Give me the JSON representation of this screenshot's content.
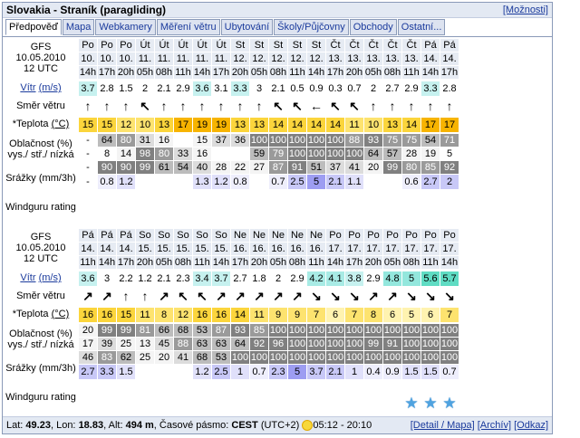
{
  "title": "Slovakia - Straník (paragliding)",
  "moznosti": "[Možnosti]",
  "tabs": [
    "Předpověď",
    "Mapa",
    "Webkamery",
    "Měření větru",
    "Ubytování",
    "Školy/Půjčovny",
    "Obchody",
    "Ostatní..."
  ],
  "labels": {
    "model": "GFS",
    "date": "10.05.2010",
    "utc": "12 UTC",
    "wind": "Vítr",
    "wind_unit": "(m/s)",
    "dir": "Směr větru",
    "temp": "*Teplota",
    "temp_unit": "(°C)",
    "cloud1": "Oblačnost (%)",
    "cloud2": "vys./ stř./ nízká",
    "rain": "Srážky (mm/3h)",
    "rating": "Windguru rating"
  },
  "blocks": [
    {
      "days": [
        "Po",
        "Po",
        "Po",
        "Út",
        "Út",
        "Út",
        "Út",
        "Út",
        "St",
        "St",
        "St",
        "St",
        "St",
        "Čt",
        "Čt",
        "Čt",
        "Čt",
        "Čt",
        "Pá",
        "Pá"
      ],
      "dates": [
        "10.",
        "10.",
        "10.",
        "11.",
        "11.",
        "11.",
        "11.",
        "11.",
        "12.",
        "12.",
        "12.",
        "12.",
        "12.",
        "13.",
        "13.",
        "13.",
        "13.",
        "13.",
        "14.",
        "14."
      ],
      "times": [
        "14h",
        "17h",
        "20h",
        "05h",
        "08h",
        "11h",
        "14h",
        "17h",
        "20h",
        "05h",
        "08h",
        "11h",
        "14h",
        "17h",
        "20h",
        "05h",
        "08h",
        "11h",
        "14h",
        "17h"
      ],
      "wind": [
        "3.7",
        "2.8",
        "1.5",
        "2",
        "2.1",
        "2.9",
        "3.6",
        "3.1",
        "3.3",
        "3",
        "2.1",
        "0.5",
        "0.9",
        "0.3",
        "0.7",
        "2",
        "2.7",
        "2.9",
        "3.3",
        "2.8"
      ],
      "wind_colors": [
        "#c6f1ef",
        "",
        "",
        "",
        "",
        "",
        "#c6f1ef",
        "",
        "#c6f1ef",
        "",
        "",
        "",
        "",
        "",
        "",
        "",
        "",
        "",
        "#c6f1ef",
        ""
      ],
      "dir": [
        "↑",
        "↑",
        "↑",
        "↖",
        "↑",
        "↑",
        "↑",
        "↑",
        "↑",
        "↑",
        "↖",
        "↖",
        "←",
        "↖",
        "↖",
        "↑",
        "↑",
        "↑",
        "↑",
        "↑"
      ],
      "temp": [
        "15",
        "15",
        "12",
        "10",
        "13",
        "17",
        "19",
        "19",
        "13",
        "13",
        "14",
        "14",
        "14",
        "14",
        "11",
        "10",
        "13",
        "14",
        "17",
        "17"
      ],
      "temp_colors": [
        "#fbd53c",
        "#fbd53c",
        "#fde36f",
        "#fde36f",
        "#fbd53c",
        "#f7b400",
        "#f7b400",
        "#f7b400",
        "#fbd53c",
        "#fbd53c",
        "#fbd53c",
        "#fbd53c",
        "#fbd53c",
        "#fbd53c",
        "#fde36f",
        "#fde36f",
        "#fbd53c",
        "#fbd53c",
        "#f7b400",
        "#f7b400"
      ],
      "cloud_h": [
        "-",
        "64",
        "80",
        "31",
        "16",
        "",
        "15",
        "37",
        "36",
        "100",
        "100",
        "100",
        "100",
        "100",
        "88",
        "93",
        "75",
        "75",
        "54",
        "71"
      ],
      "cloud_m": [
        "-",
        "8",
        "14",
        "98",
        "80",
        "33",
        "16",
        "",
        "",
        "59",
        "79",
        "100",
        "100",
        "100",
        "100",
        "64",
        "57",
        "28",
        "19",
        "5"
      ],
      "cloud_l": [
        "-",
        "90",
        "90",
        "99",
        "61",
        "54",
        "40",
        "28",
        "22",
        "27",
        "87",
        "91",
        "51",
        "37",
        "41",
        "20",
        "99",
        "80",
        "85",
        "92"
      ],
      "rain": [
        "-",
        "0.8",
        "1.2",
        "",
        "",
        "",
        "1.3",
        "1.2",
        "0.8",
        "",
        "0.7",
        "2.5",
        "5",
        "2.1",
        "1.1",
        "",
        "",
        "0.6",
        "2.7",
        "2"
      ],
      "rating": [
        0,
        0,
        0,
        0,
        0,
        0,
        0,
        0,
        0,
        0,
        0,
        0,
        0,
        0,
        0,
        0,
        0,
        0,
        0,
        0
      ]
    },
    {
      "days": [
        "Pá",
        "Pá",
        "Pá",
        "So",
        "So",
        "So",
        "So",
        "So",
        "Ne",
        "Ne",
        "Ne",
        "Ne",
        "Ne",
        "Po",
        "Po",
        "Po",
        "Po",
        "Po",
        "Po",
        "Po"
      ],
      "dates": [
        "14.",
        "14.",
        "14.",
        "15.",
        "15.",
        "15.",
        "15.",
        "15.",
        "16.",
        "16.",
        "16.",
        "16.",
        "16.",
        "17.",
        "17.",
        "17.",
        "17.",
        "17.",
        "17.",
        "17."
      ],
      "times": [
        "11h",
        "14h",
        "17h",
        "20h",
        "05h",
        "08h",
        "11h",
        "14h",
        "17h",
        "20h",
        "05h",
        "08h",
        "11h",
        "14h",
        "17h",
        "20h",
        "05h",
        "08h",
        "11h",
        "14h"
      ],
      "wind": [
        "3.6",
        "3",
        "2.2",
        "1.2",
        "2.1",
        "2.3",
        "3.4",
        "3.7",
        "2.7",
        "1.8",
        "2",
        "2.9",
        "4.2",
        "4.1",
        "3.8",
        "2.9",
        "4.8",
        "5",
        "5.6",
        "5.7"
      ],
      "wind_colors": [
        "#c6f1ef",
        "",
        "",
        "",
        "",
        "",
        "#c6f1ef",
        "#c6f1ef",
        "",
        "",
        "",
        "",
        "#a8ebe5",
        "#a8ebe5",
        "#c6f1ef",
        "",
        "#93e7dd",
        "#93e7dd",
        "#5fdcc3",
        "#5fdcc3"
      ],
      "dir": [
        "↗",
        "↗",
        "↑",
        "↑",
        "↗",
        "↖",
        "↖",
        "↗",
        "↗",
        "↗",
        "↗",
        "↗",
        "↘",
        "↘",
        "↘",
        "↗",
        "↗",
        "↘",
        "↘",
        "↘"
      ],
      "temp": [
        "16",
        "16",
        "15",
        "11",
        "8",
        "12",
        "16",
        "16",
        "14",
        "11",
        "9",
        "9",
        "7",
        "6",
        "7",
        "8",
        "6",
        "5",
        "6",
        "7"
      ],
      "temp_colors": [
        "#fbd53c",
        "#fbd53c",
        "#fbd53c",
        "#fde36f",
        "#fde36f",
        "#fde36f",
        "#fbd53c",
        "#fbd53c",
        "#fbd53c",
        "#fde36f",
        "#fde36f",
        "#fde36f",
        "#fde36f",
        "#fff3b0",
        "#fde36f",
        "#fde36f",
        "#fff3b0",
        "#fff3b0",
        "#fff3b0",
        "#fde36f"
      ],
      "cloud_h": [
        "20",
        "99",
        "99",
        "81",
        "66",
        "68",
        "53",
        "87",
        "93",
        "85",
        "100",
        "100",
        "100",
        "100",
        "100",
        "100",
        "100",
        "100",
        "100",
        "100"
      ],
      "cloud_m": [
        "17",
        "39",
        "25",
        "13",
        "45",
        "88",
        "63",
        "63",
        "64",
        "92",
        "96",
        "100",
        "100",
        "100",
        "100",
        "99",
        "91",
        "100",
        "100",
        "100"
      ],
      "cloud_l": [
        "46",
        "83",
        "62",
        "25",
        "20",
        "41",
        "68",
        "53",
        "100",
        "100",
        "100",
        "100",
        "100",
        "100",
        "100",
        "100",
        "100",
        "100",
        "100",
        "100"
      ],
      "rain": [
        "2.7",
        "3.3",
        "1.5",
        "",
        "",
        "",
        "1.2",
        "2.5",
        "1",
        "0.7",
        "2.3",
        "5",
        "3.7",
        "2.1",
        "1",
        "0.4",
        "0.9",
        "1.5",
        "1.5",
        "0.7"
      ],
      "rating": [
        0,
        0,
        0,
        0,
        0,
        0,
        0,
        0,
        0,
        0,
        0,
        0,
        0,
        0,
        0,
        0,
        0,
        1,
        1,
        1
      ]
    }
  ],
  "footer": {
    "lat_label": "Lat:",
    "lat": "49.23",
    "lon_label": "Lon:",
    "lon": "18.83",
    "alt_label": "Alt:",
    "alt": "494 m",
    "tz_label": "Časové pásmo:",
    "tz": "CEST",
    "tz_offset": "(UTC+2)",
    "sun_times": "05:12 - 20:10",
    "links": [
      "[Detail / Mapa]",
      "[Archív]",
      "[Odkaz]"
    ]
  },
  "colors": {
    "tab_border": "#8a9ab8",
    "link": "#1a3a9c",
    "star": "#4fa3e0"
  }
}
